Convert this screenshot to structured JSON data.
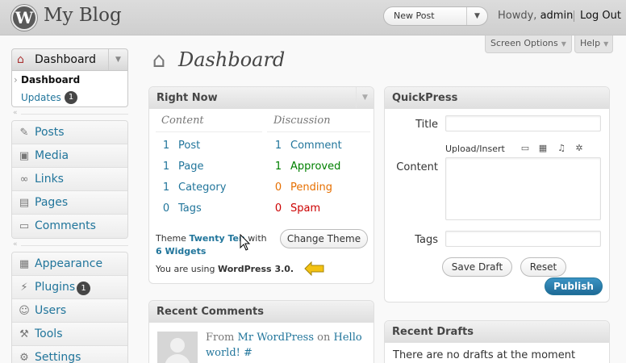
{
  "header": {
    "site_title": "My Blog",
    "logo_letter": "W",
    "favorite_action": "New Post",
    "howdy_prefix": "Howdy,",
    "user": "admin",
    "logout": "Log Out"
  },
  "screen_meta": {
    "screen_options": "Screen Options",
    "help": "Help"
  },
  "menu": {
    "dashboard": "Dashboard",
    "sub": {
      "dashboard": "Dashboard",
      "updates": "Updates",
      "updates_count": "1"
    },
    "group1": [
      {
        "label": "Posts",
        "icon": "pin-icon"
      },
      {
        "label": "Media",
        "icon": "media-icon"
      },
      {
        "label": "Links",
        "icon": "link-icon"
      },
      {
        "label": "Pages",
        "icon": "pages-icon"
      },
      {
        "label": "Comments",
        "icon": "comment-icon"
      }
    ],
    "group2": [
      {
        "label": "Appearance",
        "icon": "appearance-icon"
      },
      {
        "label": "Plugins",
        "icon": "plugin-icon",
        "badge": "1"
      },
      {
        "label": "Users",
        "icon": "users-icon"
      },
      {
        "label": "Tools",
        "icon": "tools-icon"
      },
      {
        "label": "Settings",
        "icon": "settings-icon"
      }
    ]
  },
  "page": {
    "title": "Dashboard"
  },
  "right_now": {
    "title": "Right Now",
    "content_head": "Content",
    "discussion_head": "Discussion",
    "content": [
      {
        "num": "1",
        "label": "Post"
      },
      {
        "num": "1",
        "label": "Page"
      },
      {
        "num": "1",
        "label": "Category"
      },
      {
        "num": "0",
        "label": "Tags"
      }
    ],
    "discussion": [
      {
        "num": "1",
        "label": "Comment"
      },
      {
        "num": "1",
        "label": "Approved"
      },
      {
        "num": "0",
        "label": "Pending"
      },
      {
        "num": "0",
        "label": "Spam"
      }
    ],
    "theme_prefix": "Theme",
    "theme_name": "Twenty Ten",
    "theme_with": "with",
    "widgets": "6 Widgets",
    "change_theme": "Change Theme",
    "version_prefix": "You are using",
    "version": "WordPress 3.0."
  },
  "quickpress": {
    "title": "QuickPress",
    "title_label": "Title",
    "upload_label": "Upload/Insert",
    "content_label": "Content",
    "tags_label": "Tags",
    "save_draft": "Save Draft",
    "reset": "Reset",
    "publish": "Publish"
  },
  "recent_comments": {
    "title": "Recent Comments",
    "from": "From",
    "author": "Mr WordPress",
    "on": "on",
    "post": "Hello world! #"
  },
  "recent_drafts": {
    "title": "Recent Drafts",
    "empty": "There are no drafts at the moment"
  },
  "colors": {
    "link": "#21759b",
    "approved": "#008000",
    "pending": "#e66f00",
    "spam": "#cc0000",
    "publish": "#21759b"
  }
}
